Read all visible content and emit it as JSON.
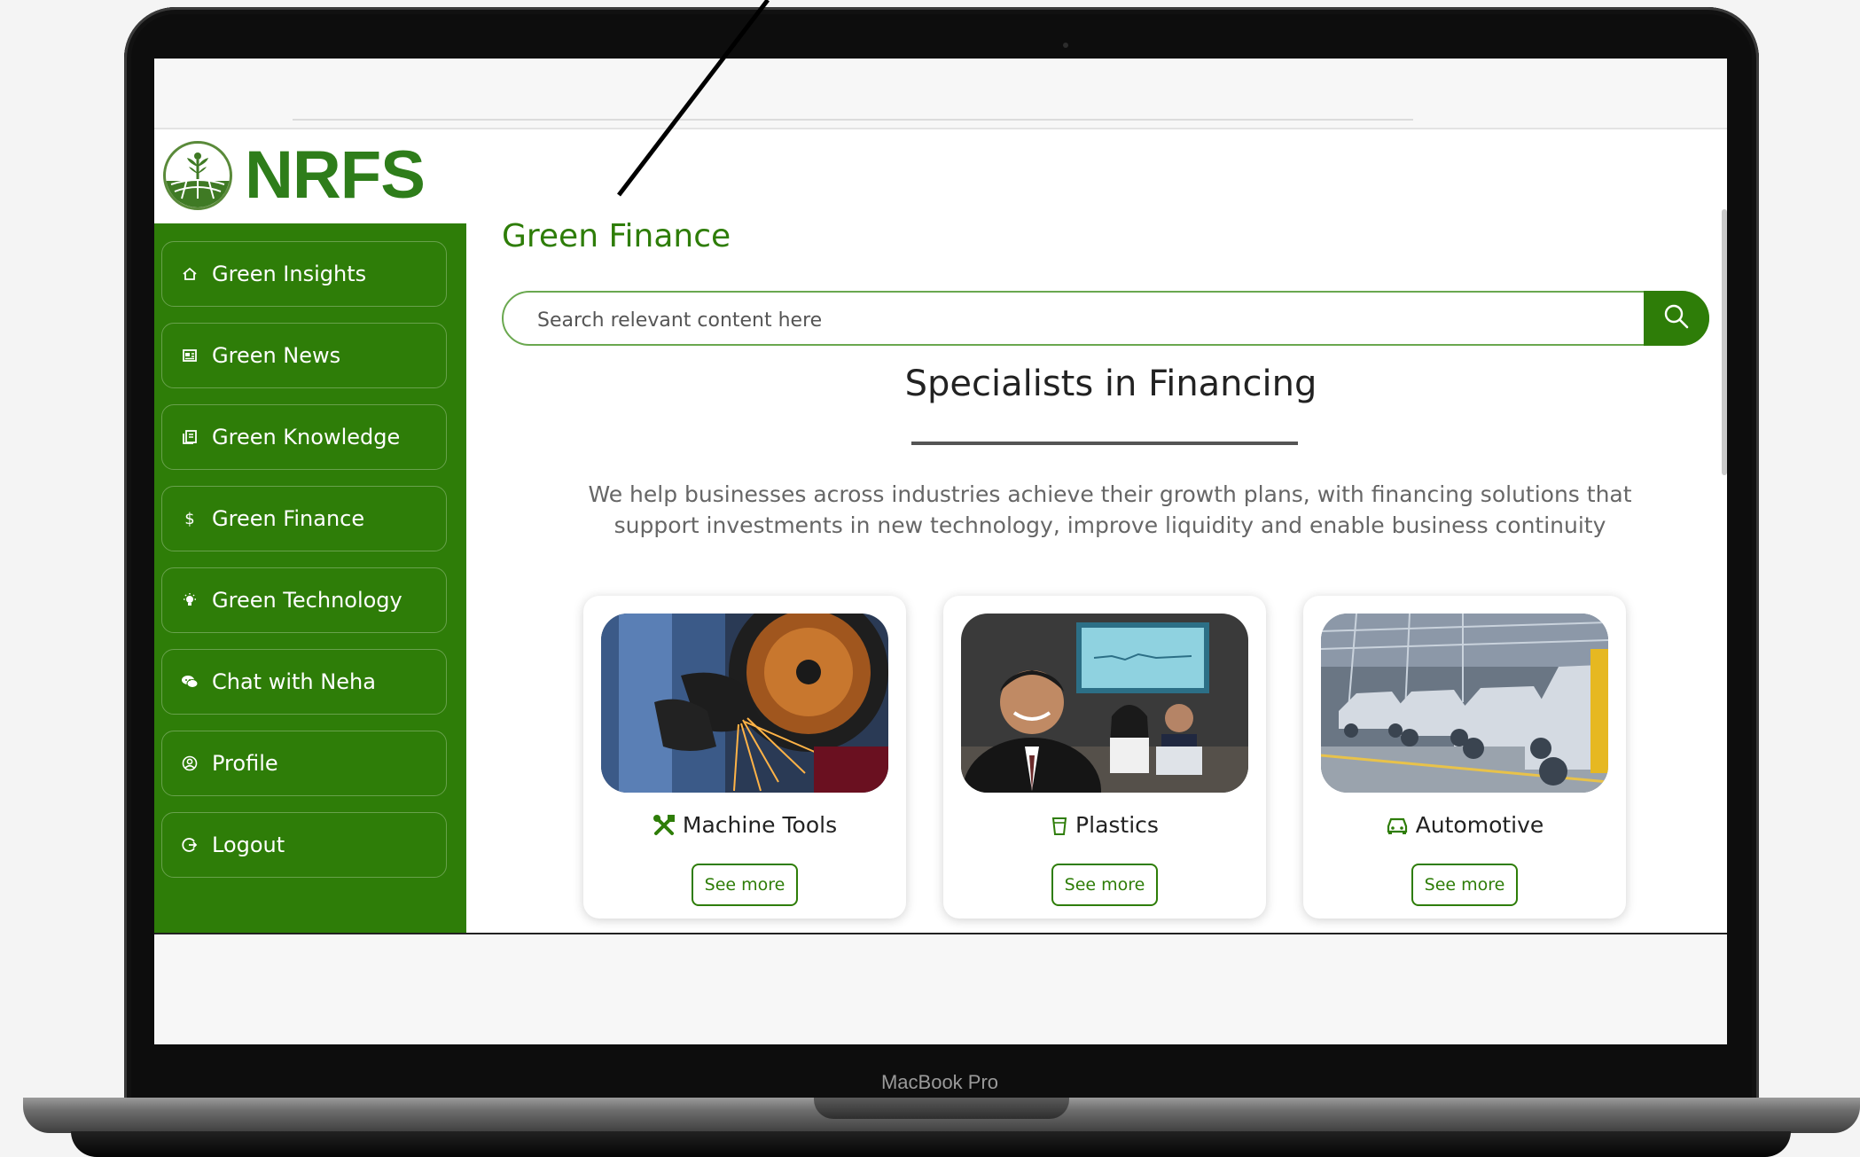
{
  "device": {
    "label": "MacBook Pro"
  },
  "brand": {
    "name": "NRFS",
    "color": "#2e7d08"
  },
  "sidebar": {
    "items": [
      {
        "label": "Green Insights",
        "icon": "home-icon"
      },
      {
        "label": "Green News",
        "icon": "newspaper-icon"
      },
      {
        "label": "Green Knowledge",
        "icon": "book-icon"
      },
      {
        "label": "Green Finance",
        "icon": "dollar-icon"
      },
      {
        "label": "Green Technology",
        "icon": "lightbulb-icon"
      },
      {
        "label": "Chat with Neha",
        "icon": "chat-icon"
      },
      {
        "label": "Profile",
        "icon": "user-circle-icon"
      },
      {
        "label": "Logout",
        "icon": "logout-icon"
      }
    ]
  },
  "main": {
    "page_title": "Green Finance",
    "search": {
      "placeholder": "Search relevant content here"
    },
    "section_title": "Specialists in Financing",
    "intro": "We help businesses across industries achieve their growth plans, with financing solutions that support investments in new technology, improve liquidity and enable business continuity",
    "cards": [
      {
        "title": "Machine Tools",
        "icon": "tools-icon",
        "button": "See more"
      },
      {
        "title": "Plastics",
        "icon": "cup-icon",
        "button": "See more"
      },
      {
        "title": "Automotive",
        "icon": "car-icon",
        "button": "See more"
      }
    ]
  }
}
